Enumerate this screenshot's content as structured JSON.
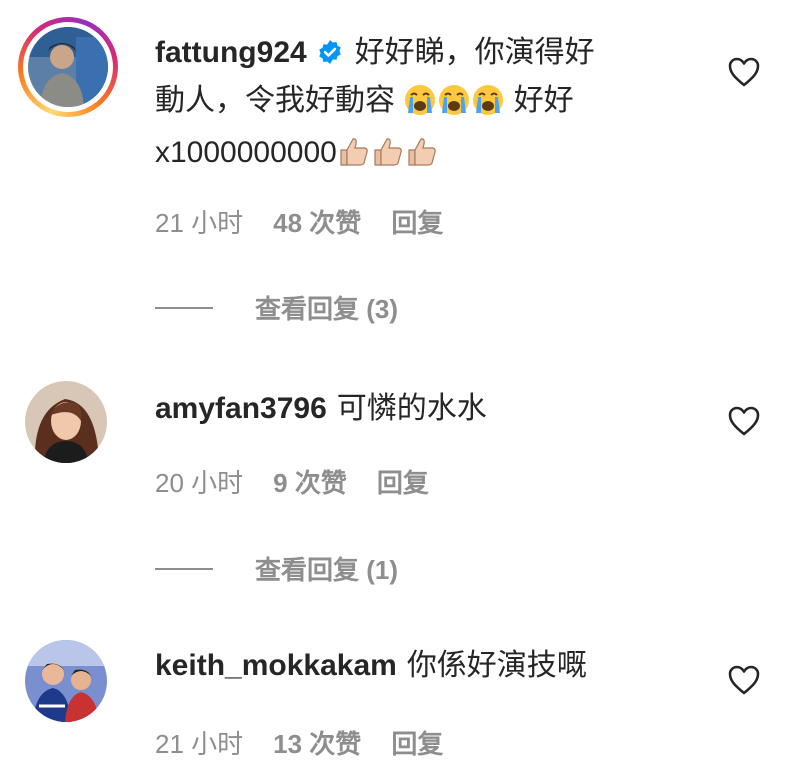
{
  "comments": [
    {
      "username": "fattung924",
      "verified": true,
      "text_line1": "好好睇，你演得好",
      "text_line2_a": "動人，令我好動容",
      "text_line2_b": "好好",
      "text_line3": "x1000000000",
      "emoji_face": "loudly-crying-face",
      "emoji_thumb": "thumbs-up-light-skin",
      "time": "21 小时",
      "likes": "48 次赞",
      "reply": "回复",
      "view_replies": "查看回复 (3)"
    },
    {
      "username": "amyfan3796",
      "text": "可憐的水水",
      "time": "20 小时",
      "likes": "9 次赞",
      "reply": "回复",
      "view_replies": "查看回复 (1)"
    },
    {
      "username": "keith_mokkakam",
      "text": "你係好演技嘅",
      "time": "21 小时",
      "likes": "13 次赞",
      "reply": "回复"
    }
  ],
  "icons": {
    "like": "heart-outline-icon",
    "verified": "verified-badge-icon"
  },
  "colors": {
    "text": "#262626",
    "secondary": "#8e8e8e",
    "verified": "#0095f6"
  }
}
